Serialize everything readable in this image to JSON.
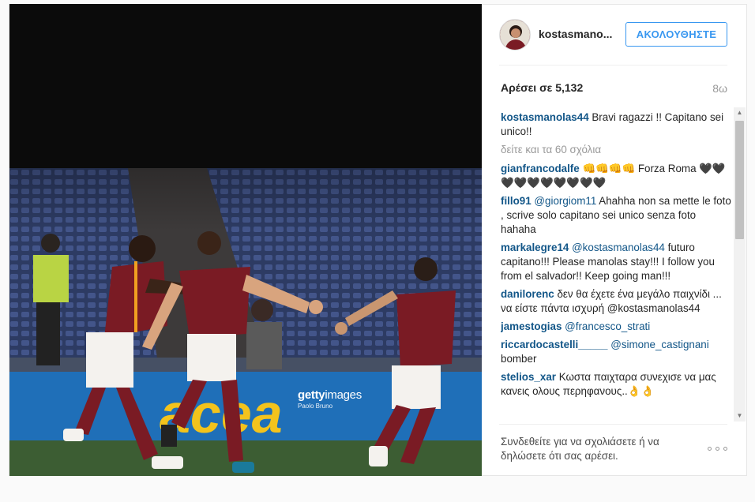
{
  "post": {
    "username": "kostasmano...",
    "follow_label": "ΑΚΟΛΟΥΘΗΣΤΕ",
    "likes": "Αρέσει σε 5,132",
    "time": "8ω"
  },
  "photo": {
    "watermark_logo": "getty",
    "watermark_logo_suffix": "images",
    "watermark_credit": "Paolo Bruno",
    "banner_text": "acea"
  },
  "comments": {
    "caption": {
      "user": "kostasmanolas44",
      "text": " Bravi ragazzi !! Capitano sei unico!!"
    },
    "load_more": "δείτε και τα 60 σχόλια",
    "items": [
      {
        "user": "gianfrancodalfe",
        "text": " 👊👊👊👊 Forza Roma 🖤🖤🖤🖤🖤🖤🖤🖤🖤🖤",
        "mention": ""
      },
      {
        "user": "fillo91",
        "mention": " @giorgiom11",
        "text": " Ahahha non sa mette le foto , scrive solo capitano sei unico senza foto hahaha"
      },
      {
        "user": "markalegre14",
        "mention": " @kostasmanolas44",
        "text": " futuro capitano!!! Please manolas stay!!! I follow you from el salvador!! Keep going man!!!"
      },
      {
        "user": "danilorenc",
        "mention": "",
        "text": " δεν θα έχετε ένα μεγάλο παιχνίδι ... να είστε πάντα ισχυρή @kostasmanolas44"
      },
      {
        "user": "jamestogias",
        "mention": " @francesco_strati",
        "text": ""
      },
      {
        "user": "riccardocastelli_____",
        "mention": " @simone_castignani",
        "text": " bomber"
      },
      {
        "user": "stelios_xar",
        "mention": "",
        "text": " Κωστα παιχταρα συνεχισε να μας κανεις ολους περηφανους..👌👌"
      }
    ]
  },
  "footer": {
    "prompt": "Συνδεθείτε για να σχολιάσετε ή να δηλώσετε ότι σας αρέσει."
  },
  "colors": {
    "link": "#125688",
    "accent": "#3897f0",
    "kit": "#7a1b24",
    "kit_trim": "#f0a020"
  },
  "icons": {
    "more": "more-options-icon",
    "scroll_up": "scroll-up-arrow-icon",
    "scroll_down": "scroll-down-arrow-icon"
  }
}
